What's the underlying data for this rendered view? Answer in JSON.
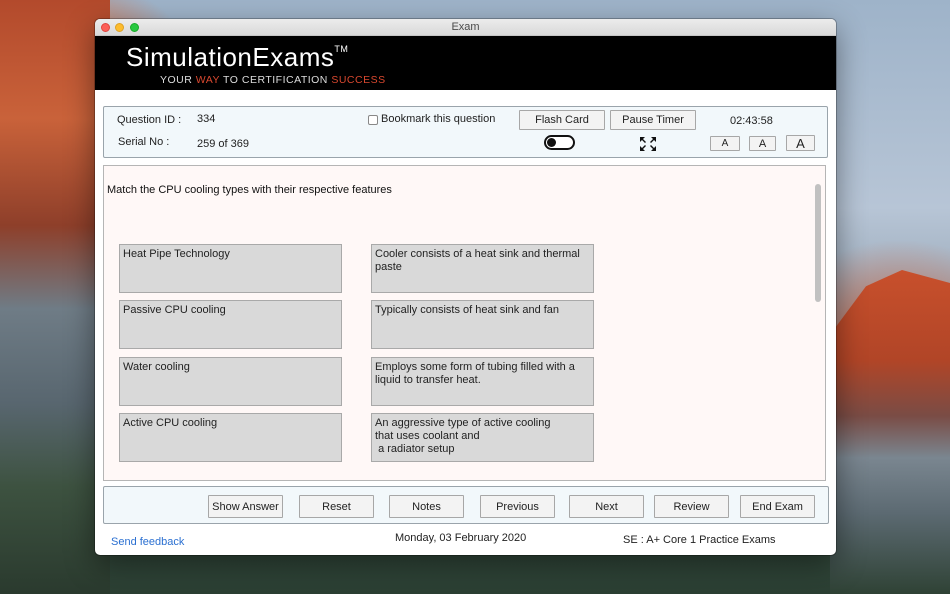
{
  "window": {
    "title": "Exam"
  },
  "banner": {
    "brand": "SimulationExams",
    "trademark": "TM",
    "tagline_part1": "YOUR ",
    "tagline_way": "WAY",
    "tagline_part2": " TO CERTIFICATION ",
    "tagline_success": "SUCCESS",
    "accent_color": "#d9482f"
  },
  "info": {
    "question_id_label": "Question ID :",
    "question_id_value": "334",
    "serial_label": "Serial No :",
    "serial_value": "259 of 369",
    "bookmark_label": "Bookmark this question",
    "flash_card_label": "Flash Card",
    "pause_timer_label": "Pause Timer",
    "timer_value": "02:43:58",
    "font_small": "A",
    "font_medium": "A",
    "font_large": "A",
    "toggle_icon": "toggle-switch",
    "fullscreen_icon": "expand-arrows-icon"
  },
  "question": {
    "text": "Match the CPU cooling types with their respective features",
    "left_items": [
      "Heat Pipe Technology",
      "Passive CPU cooling",
      "Water cooling",
      "Active CPU cooling"
    ],
    "right_items": [
      "Cooler consists of a heat sink and thermal paste",
      "Typically consists of heat sink and fan",
      "Employs some form of tubing filled with a liquid to transfer heat.",
      "An aggressive type of active cooling\nthat uses coolant and\n a radiator setup"
    ]
  },
  "nav": {
    "show_answer": "Show Answer",
    "reset": "Reset",
    "notes": "Notes",
    "previous": "Previous",
    "next": "Next",
    "review": "Review",
    "end_exam": "End Exam"
  },
  "footer": {
    "feedback": "Send feedback",
    "date": "Monday, 03 February 2020",
    "exam_name": "SE : A+ Core 1 Practice Exams",
    "link_color": "#2a6fd1"
  }
}
